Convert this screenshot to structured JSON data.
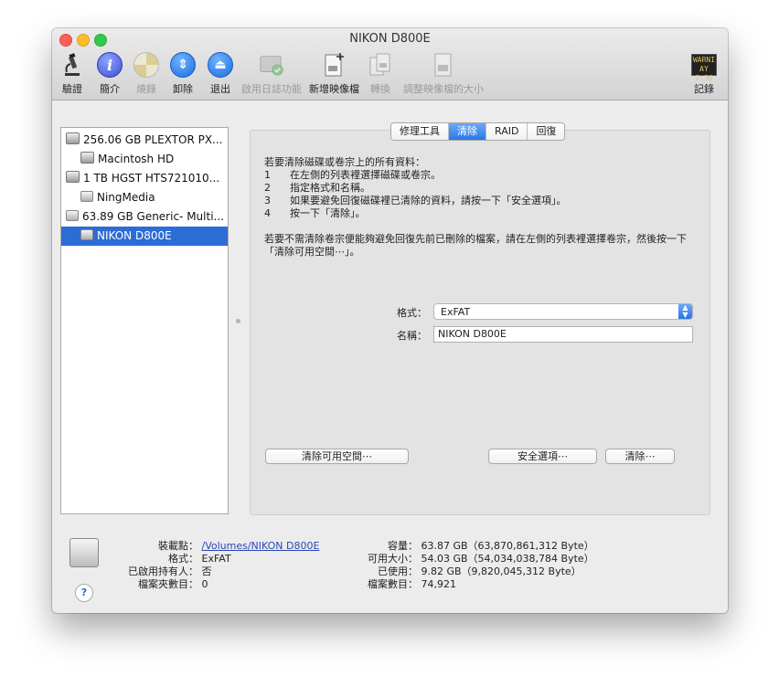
{
  "window": {
    "title": "NIKON D800E"
  },
  "toolbar": {
    "items": [
      {
        "label": "驗證",
        "icon": "microscope-icon",
        "enabled": true
      },
      {
        "label": "簡介",
        "icon": "info-icon",
        "enabled": true
      },
      {
        "label": "燒錄",
        "icon": "burn-disc-icon",
        "enabled": false
      },
      {
        "label": "卸除",
        "icon": "unmount-icon",
        "enabled": true
      },
      {
        "label": "退出",
        "icon": "eject-icon",
        "enabled": true
      },
      {
        "label": "啟用日誌功能",
        "icon": "journal-disk-icon",
        "enabled": false
      },
      {
        "label": "新增映像檔",
        "icon": "new-image-icon",
        "enabled": true
      },
      {
        "label": "轉換",
        "icon": "convert-icon",
        "enabled": false
      },
      {
        "label": "調整映像檔的大小",
        "icon": "resize-image-icon",
        "enabled": false
      },
      {
        "label": "記錄",
        "icon": "log-icon",
        "enabled": true
      }
    ],
    "log_icon_text": "WARNI\nAY 7:36"
  },
  "sidebar": {
    "items": [
      {
        "label": "256.06 GB PLEXTOR PX...",
        "type": "disk",
        "level": 0
      },
      {
        "label": "Macintosh HD",
        "type": "volume",
        "level": 1
      },
      {
        "label": "1 TB HGST HTS721010...",
        "type": "disk",
        "level": 0
      },
      {
        "label": "NingMedia",
        "type": "volume",
        "level": 1
      },
      {
        "label": "63.89 GB Generic- Multi...",
        "type": "disk",
        "level": 0
      },
      {
        "label": "NIKON D800E",
        "type": "volume",
        "level": 1,
        "selected": true
      }
    ]
  },
  "tabs": [
    {
      "label": "修理工具",
      "active": false
    },
    {
      "label": "清除",
      "active": true
    },
    {
      "label": "RAID",
      "active": false
    },
    {
      "label": "回復",
      "active": false
    }
  ],
  "erase": {
    "intro": "若要清除磁碟或卷宗上的所有資料：",
    "steps": [
      {
        "n": "1",
        "text": "在左側的列表裡選擇磁碟或卷宗。"
      },
      {
        "n": "2",
        "text": "指定格式和名稱。"
      },
      {
        "n": "3",
        "text": "如果要避免回復磁碟裡已清除的資料，請按一下「安全選項」。"
      },
      {
        "n": "4",
        "text": "按一下「清除」。"
      }
    ],
    "note": "若要不需清除卷宗便能夠避免回復先前已刪除的檔案，請在左側的列表裡選擇卷宗，然後按一下「清除可用空間⋯」。",
    "format_label": "格式：",
    "format_value": "ExFAT",
    "name_label": "名稱：",
    "name_value": "NIKON D800E",
    "btn_erase_free": "清除可用空間⋯",
    "btn_security": "安全選項⋯",
    "btn_erase": "清除⋯"
  },
  "info": {
    "mount_label": "裝載點：",
    "mount_value": "/Volumes/NIKON D800E",
    "format_label": "格式：",
    "format_value": "ExFAT",
    "owners_label": "已啟用持有人：",
    "owners_value": "否",
    "folders_label": "檔案夾數目：",
    "folders_value": "0",
    "capacity_label": "容量：",
    "capacity_value": "63.87 GB（63,870,861,312 Byte）",
    "available_label": "可用大小：",
    "available_value": "54.03 GB（54,034,038,784 Byte）",
    "used_label": "已使用：",
    "used_value": "9.82 GB（9,820,045,312 Byte）",
    "files_label": "檔案數目：",
    "files_value": "74,921",
    "help": "?"
  }
}
